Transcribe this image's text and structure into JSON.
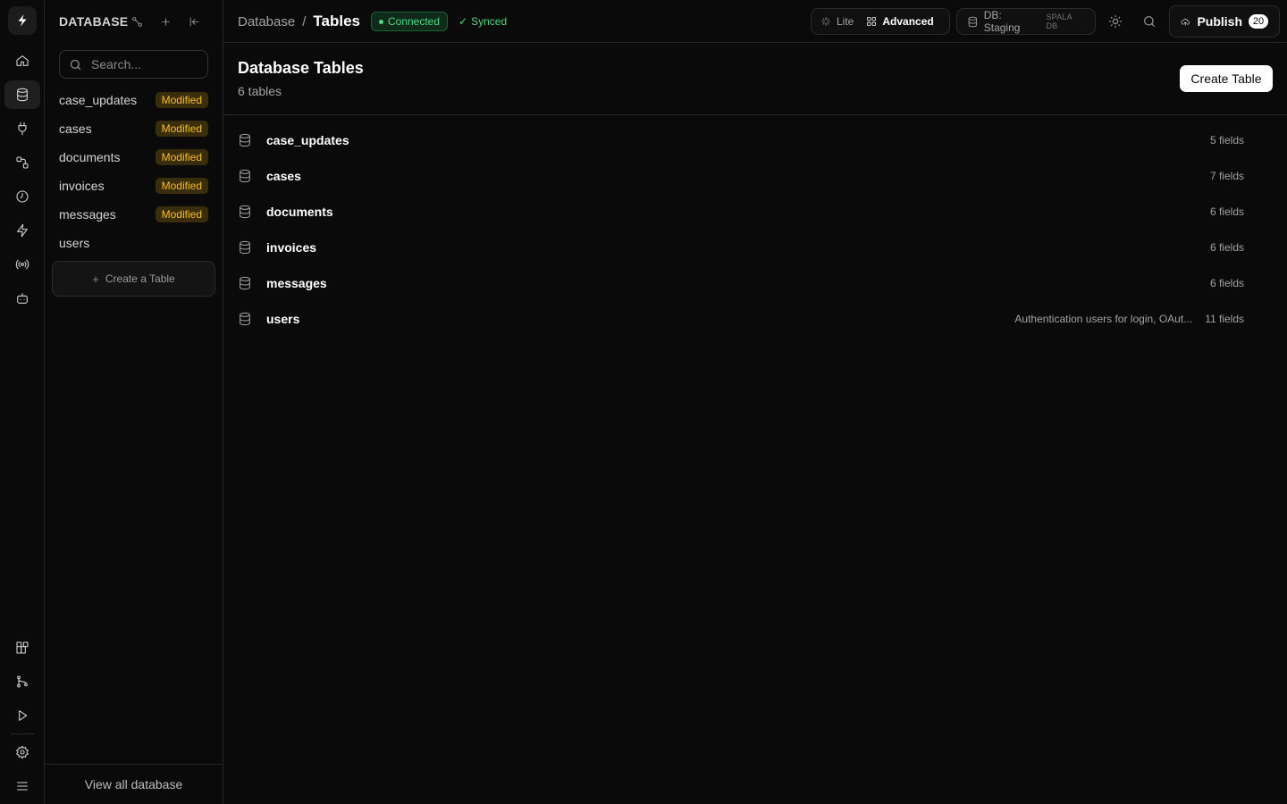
{
  "sidebar": {
    "title": "DATABASE",
    "search_placeholder": "Search...",
    "items": [
      {
        "label": "case_updates",
        "badge": "Modified"
      },
      {
        "label": "cases",
        "badge": "Modified"
      },
      {
        "label": "documents",
        "badge": "Modified"
      },
      {
        "label": "invoices",
        "badge": "Modified"
      },
      {
        "label": "messages",
        "badge": "Modified"
      },
      {
        "label": "users",
        "badge": ""
      }
    ],
    "create_label": "Create a Table",
    "footer_label": "View all database"
  },
  "header": {
    "breadcrumb_parent": "Database",
    "breadcrumb_separator": "/",
    "breadcrumb_current": "Tables",
    "status_connected": "Connected",
    "status_synced": "Synced",
    "mode_lite": "Lite",
    "mode_advanced": "Advanced",
    "db_label": "DB: Staging",
    "db_sub": "SPALA DB",
    "publish_label": "Publish",
    "publish_count": "20"
  },
  "main": {
    "title": "Database Tables",
    "subtitle": "6 tables",
    "create_button": "Create Table",
    "tables": [
      {
        "name": "case_updates",
        "description": "",
        "fields": "5 fields"
      },
      {
        "name": "cases",
        "description": "",
        "fields": "7 fields"
      },
      {
        "name": "documents",
        "description": "",
        "fields": "6 fields"
      },
      {
        "name": "invoices",
        "description": "",
        "fields": "6 fields"
      },
      {
        "name": "messages",
        "description": "",
        "fields": "6 fields"
      },
      {
        "name": "users",
        "description": "Authentication users for login, OAut...",
        "fields": "11 fields"
      }
    ]
  },
  "colors": {
    "accent_green": "#4ade80",
    "modified_amber": "#fbbf24",
    "background": "#0a0a0a"
  },
  "icons": {
    "rail_top": [
      "home-icon",
      "database-icon",
      "plug-icon",
      "workflow-icon",
      "clock-icon",
      "lightning-icon",
      "broadcast-icon",
      "bot-icon"
    ],
    "rail_bottom": [
      "extensions-icon",
      "git-branch-icon",
      "play-icon",
      "settings-icon",
      "menu-icon"
    ]
  }
}
